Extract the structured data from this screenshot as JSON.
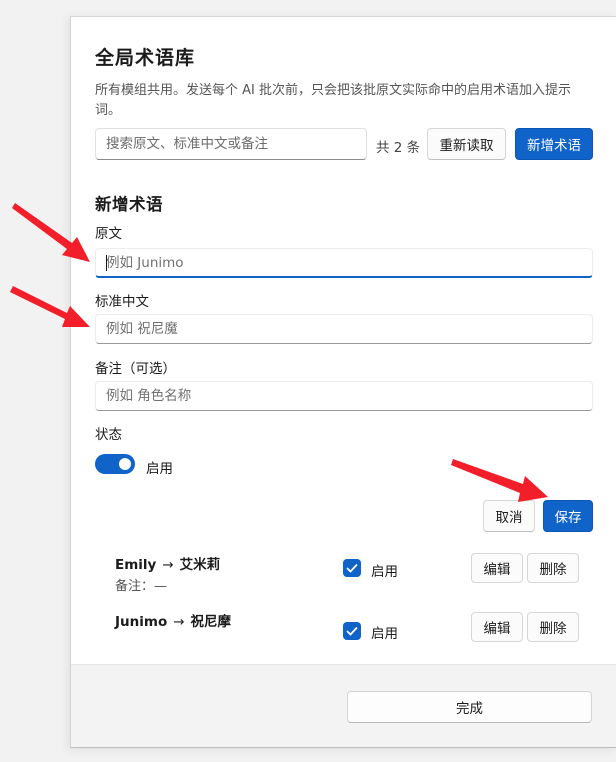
{
  "dialog": {
    "title": "全局术语库",
    "description": "所有模组共用。发送每个 AI 批次前，只会把该批原文实际命中的启用术语加入提示词。",
    "search": {
      "placeholder": "搜索原文、标准中文或备注",
      "value": ""
    },
    "count_label": "共 2 条",
    "reload_label": "重新读取",
    "add_label": "新增术语"
  },
  "new_term": {
    "section_title": "新增术语",
    "source": {
      "label": "原文",
      "placeholder": "例如 Junimo",
      "value": ""
    },
    "target": {
      "label": "标准中文",
      "placeholder": "例如 祝尼魔",
      "value": ""
    },
    "note": {
      "label": "备注（可选）",
      "placeholder": "例如 角色名称",
      "value": ""
    },
    "status": {
      "label": "状态",
      "toggle_label": "启用",
      "on": true
    },
    "cancel_label": "取消",
    "save_label": "保存"
  },
  "terms": [
    {
      "source": "Emily",
      "arrow": "→",
      "target": "艾米莉",
      "note": "备注：—",
      "enabled": true,
      "enabled_label": "启用",
      "edit_label": "编辑",
      "delete_label": "删除"
    },
    {
      "source": "Junimo",
      "arrow": "→",
      "target": "祝尼摩",
      "note": "",
      "enabled": true,
      "enabled_label": "启用",
      "edit_label": "编辑",
      "delete_label": "删除"
    }
  ],
  "footer": {
    "done_label": "完成"
  },
  "colors": {
    "accent": "#0f63c9",
    "annotation_arrow": "#f21e2a",
    "footer_bg": "#f3f3f3"
  }
}
